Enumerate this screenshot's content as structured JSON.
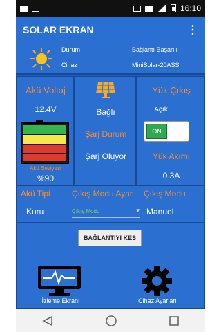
{
  "status_bar": {
    "time": "16:10"
  },
  "app_bar": {
    "title": "SOLAR EKRAN",
    "menu_icon": "more-vert-icon"
  },
  "info": {
    "durum_label": "Durum",
    "durum_value": "Bağlantı Başarılı",
    "cihaz_label": "Cihaz",
    "cihaz_value": "MiniSolar-20ASS",
    "sun_icon": "sun-icon"
  },
  "aku": {
    "title": "Akü Voltaj",
    "voltage": "12.4V",
    "level_label": "Akü Seviyesi",
    "level_value": "%90",
    "level_fraction": 0.9
  },
  "solar": {
    "status_value": "Bağlı",
    "sarj_title": "Şarj Durum",
    "sarj_value": "Şarj Oluyor"
  },
  "yuk": {
    "title": "Yük Çıkış",
    "state": "Açık",
    "toggle_label": "ON",
    "akim_title": "Yük Akımı",
    "akim_value": "0.3A"
  },
  "settings_row": {
    "aku_tipi_title": "Akü Tipi",
    "aku_tipi_value": "Kuru",
    "cikis_ayar_title": "Çıkış Modu Ayar",
    "cikis_ayar_placeholder": "Çıkış Modu",
    "cikis_modu_title": "Çıkış Modu",
    "cikis_modu_value": "Manuel"
  },
  "disconnect_button": "BAĞLANTIYI KES",
  "bottom": {
    "izleme_label": "İzleme Ekranı",
    "ayar_label": "Cihaz Ayarları"
  },
  "colors": {
    "app_bar": "#2a6fd2",
    "panel": "#2b6fd1",
    "orange_text": "#ff8c2a",
    "toggle_on": "#2fa84f"
  }
}
